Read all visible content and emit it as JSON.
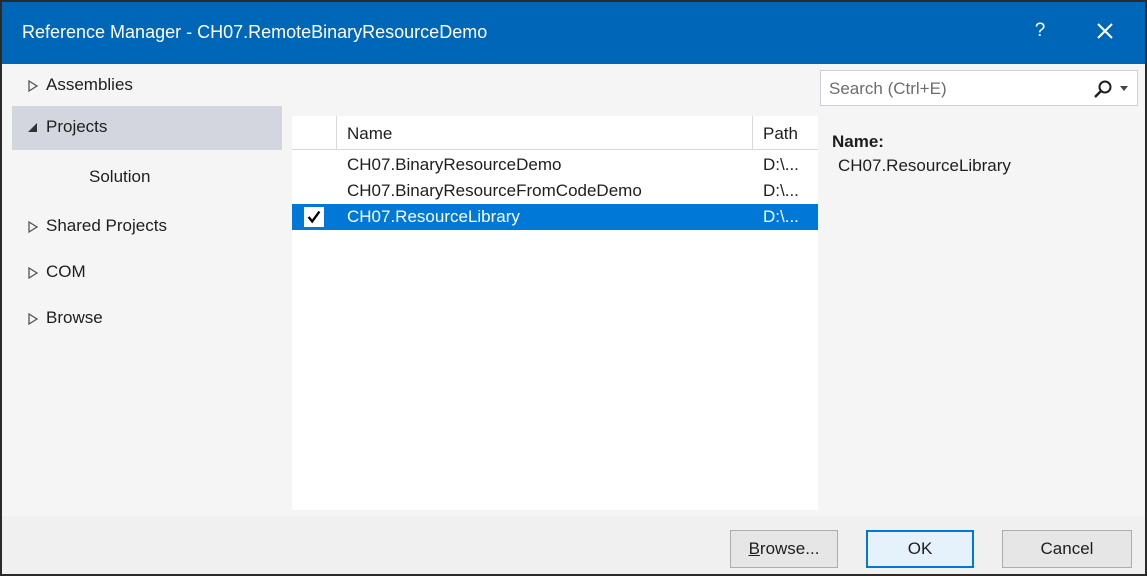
{
  "window": {
    "title": "Reference Manager - CH07.RemoteBinaryResourceDemo",
    "help_label": "?",
    "accent_color": "#0067b8"
  },
  "nav": {
    "items": [
      {
        "label": "Assemblies",
        "icon": "expand-arrow-icon",
        "selected": false
      },
      {
        "label": "Projects",
        "icon": "collapse-arrow-icon",
        "selected": true
      },
      {
        "label": "Solution",
        "icon": "",
        "selected": false
      },
      {
        "label": "Shared Projects",
        "icon": "expand-arrow-icon",
        "selected": false
      },
      {
        "label": "COM",
        "icon": "expand-arrow-icon",
        "selected": false
      },
      {
        "label": "Browse",
        "icon": "expand-arrow-icon",
        "selected": false
      }
    ]
  },
  "list": {
    "columns": {
      "name": "Name",
      "path": "Path"
    },
    "rows": [
      {
        "name": "CH07.BinaryResourceDemo",
        "path": "D:\\...",
        "checked": false,
        "selected": false
      },
      {
        "name": "CH07.BinaryResourceFromCodeDemo",
        "path": "D:\\...",
        "checked": false,
        "selected": false
      },
      {
        "name": "CH07.ResourceLibrary",
        "path": "D:\\...",
        "checked": true,
        "selected": true
      }
    ],
    "selected_color": "#0078d7"
  },
  "search": {
    "placeholder": "Search (Ctrl+E)",
    "value": ""
  },
  "details": {
    "name_label": "Name:",
    "name_value": "CH07.ResourceLibrary"
  },
  "footer": {
    "browse_first": "B",
    "browse_rest": "rowse...",
    "ok_label": "OK",
    "cancel_label": "Cancel"
  }
}
